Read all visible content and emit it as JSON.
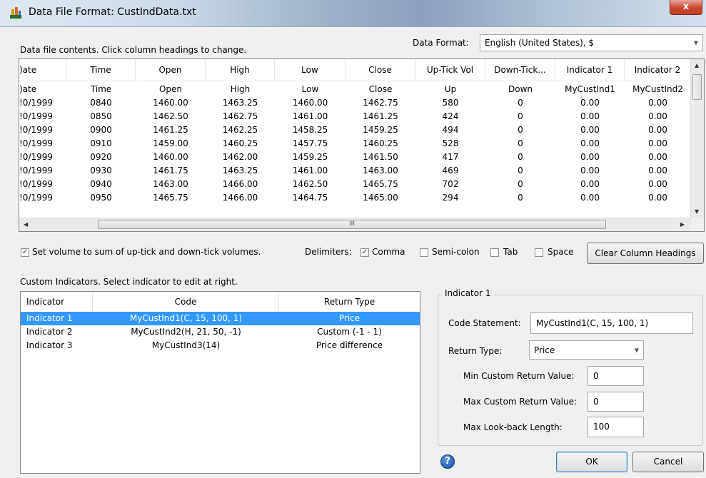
{
  "window": {
    "title": "Data File Format: CustIndData.txt",
    "close_label": "x"
  },
  "data_format": {
    "label": "Data Format:",
    "value": "English (United States), $"
  },
  "contents_label": "Data file contents. Click column headings to change.",
  "grid": {
    "headers": [
      ")ate",
      "Time",
      "Open",
      "High",
      "Low",
      "Close",
      "Up-Tick Vol",
      "Down-Tick...",
      "Indicator 1",
      "Indicator 2"
    ],
    "rows": [
      [
        ")ate",
        "Time",
        "Open",
        "High",
        "Low",
        "Close",
        "Up",
        "Down",
        "MyCustInd1",
        "MyCustInd2"
      ],
      [
        "!0/1999",
        "0840",
        "1460.00",
        "1463.25",
        "1460.00",
        "1462.75",
        "580",
        "0",
        "0.00",
        "0.00"
      ],
      [
        "!0/1999",
        "0850",
        "1462.50",
        "1462.75",
        "1461.00",
        "1461.25",
        "424",
        "0",
        "0.00",
        "0.00"
      ],
      [
        "!0/1999",
        "0900",
        "1461.25",
        "1462.25",
        "1458.25",
        "1459.25",
        "494",
        "0",
        "0.00",
        "0.00"
      ],
      [
        "!0/1999",
        "0910",
        "1459.00",
        "1460.25",
        "1457.75",
        "1460.25",
        "528",
        "0",
        "0.00",
        "0.00"
      ],
      [
        "!0/1999",
        "0920",
        "1460.00",
        "1462.00",
        "1459.25",
        "1461.50",
        "417",
        "0",
        "0.00",
        "0.00"
      ],
      [
        "!0/1999",
        "0930",
        "1461.75",
        "1463.25",
        "1461.00",
        "1463.00",
        "469",
        "0",
        "0.00",
        "0.00"
      ],
      [
        "!0/1999",
        "0940",
        "1463.00",
        "1466.00",
        "1462.50",
        "1465.75",
        "702",
        "0",
        "0.00",
        "0.00"
      ],
      [
        "!0/1999",
        "0950",
        "1465.75",
        "1466.00",
        "1464.75",
        "1465.00",
        "294",
        "0",
        "0.00",
        "0.00"
      ]
    ],
    "hscroll_grip": "III"
  },
  "options": {
    "set_volume_label": "Set volume to sum of up-tick and down-tick volumes.",
    "delimiters_label": "Delimiters:",
    "comma": "Comma",
    "semicolon": "Semi-colon",
    "tab": "Tab",
    "space": "Space",
    "clear_button": "Clear Column Headings"
  },
  "custom_label": "Custom Indicators. Select indicator to edit at right.",
  "indicator_list": {
    "headers": [
      "Indicator",
      "Code",
      "Return Type"
    ],
    "rows": [
      [
        "Indicator 1",
        "MyCustInd1(C, 15, 100, 1)",
        "Price"
      ],
      [
        "Indicator 2",
        "MyCustInd2(H, 21, 50, -1)",
        "Custom (-1 - 1)"
      ],
      [
        "Indicator 3",
        "MyCustInd3(14)",
        "Price difference"
      ]
    ]
  },
  "editor": {
    "group_title": "Indicator 1",
    "code_label": "Code Statement:",
    "code_value": "MyCustInd1(C, 15, 100, 1)",
    "return_label": "Return Type:",
    "return_value": "Price",
    "min_label": "Min Custom Return Value:",
    "min_value": "0",
    "max_label": "Max Custom Return Value:",
    "max_value": "0",
    "lookback_label": "Max Look-back Length:",
    "lookback_value": "100"
  },
  "buttons": {
    "help": "?",
    "ok": "OK",
    "cancel": "Cancel"
  }
}
